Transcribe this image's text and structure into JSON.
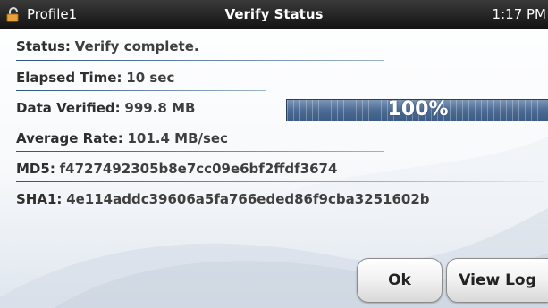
{
  "titlebar": {
    "profile": "Profile1",
    "title": "Verify Status",
    "clock": "1:17 PM",
    "icon": "lock-icon"
  },
  "fields": [
    {
      "label": "Status",
      "value": "Verify complete."
    },
    {
      "label": "Elapsed Time",
      "value": "10 sec"
    },
    {
      "label": "Data Verified",
      "value": "999.8 MB"
    },
    {
      "label": "Average Rate",
      "value": "101.4 MB/sec"
    },
    {
      "label": "MD5",
      "value": "f4727492305b8e7cc09e6bf2ffdf3674"
    },
    {
      "label": "SHA1",
      "value": "4e114addc39606a5fa766eded86f9cba3251602b"
    }
  ],
  "progress": {
    "text": "100%",
    "fraction": 1.0
  },
  "buttons": {
    "ok": "Ok",
    "view_log": "View Log"
  },
  "colors": {
    "underline": "#2f5580",
    "titlebar": "#1a1a1a",
    "progress": "#4d6c94"
  }
}
